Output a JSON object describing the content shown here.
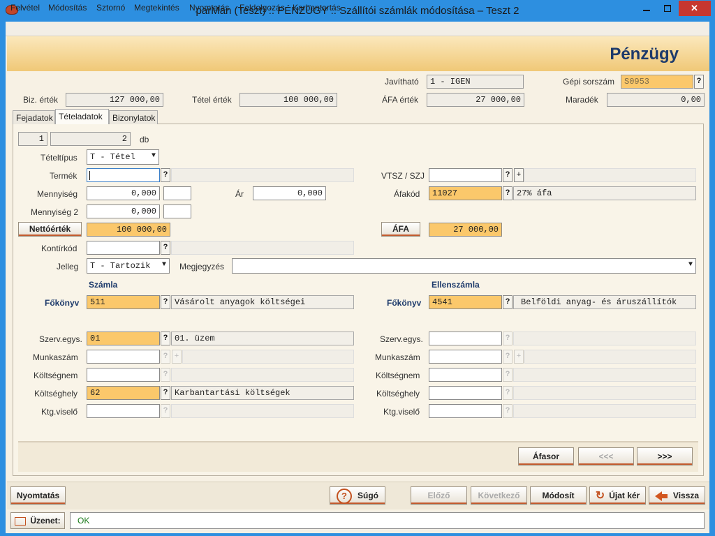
{
  "window": {
    "title": "parMan (Teszt) :: PÉNZÜGY :: Szállítói számlák módosítása   –   Teszt 2"
  },
  "menu": [
    "Felvétel",
    "Módosítás",
    "Sztornó",
    "Megtekintés",
    "Nyomtatás",
    "Feldolgozás",
    "Karbantartás"
  ],
  "banner": {
    "title": "Pénzügy"
  },
  "header": {
    "javithato_label": "Javítható",
    "javithato_value": "1 - IGEN",
    "gepi_label": "Gépi sorszám",
    "gepi_value": "S0953",
    "biz_label": "Biz. érték",
    "biz_value": "127 000,00",
    "tetel_label": "Tétel érték",
    "tetel_value": "100 000,00",
    "afa_label": "ÁFA érték",
    "afa_value": "27 000,00",
    "maradek_label": "Maradék",
    "maradek_value": "0,00"
  },
  "tabs": [
    "Fejadatok",
    "Tételadatok",
    "Bizonylatok"
  ],
  "counter": {
    "current": "1",
    "total": "2",
    "unit": "db"
  },
  "form": {
    "teteltipus_label": "Tételtípus",
    "teteltipus_value": "T - Tétel",
    "termek_label": "Termék",
    "termek_value": "",
    "vtsz_label": "VTSZ / SZJ",
    "vtsz_value": "",
    "mennyiseg_label": "Mennyiség",
    "mennyiseg_value": "0,000",
    "ar_label": "Ár",
    "ar_value": "0,000",
    "afakod_label": "Áfakód",
    "afakod_value": "11027",
    "afakod_desc": "27% áfa",
    "mennyiseg2_label": "Mennyiség 2",
    "mennyiseg2_value": "0,000",
    "netto_button": "Nettóérték",
    "netto_value": "100 000,00",
    "afa_button": "ÁFA",
    "afa_value": "27 000,00",
    "kontir_label": "Kontírkód",
    "kontir_value": "",
    "jelleg_label": "Jelleg",
    "jelleg_value": "T - Tartozik",
    "megjegyzes_label": "Megjegyzés",
    "megjegyzes_value": ""
  },
  "szamla": {
    "heading": "Számla",
    "fokonyv_label": "Főkönyv",
    "fokonyv_value": "511",
    "fokonyv_desc": "Vásárolt anyagok költségei",
    "szerv_label": "Szerv.egys.",
    "szerv_value": "01",
    "szerv_desc": "01. üzem",
    "munka_label": "Munkaszám",
    "koltsegnem_label": "Költségnem",
    "koltseghely_label": "Költséghely",
    "koltseghely_value": "62",
    "koltseghely_desc": "Karbantartási költségek",
    "ktg_label": "Ktg.viselő"
  },
  "ellenszamla": {
    "heading": "Ellenszámla",
    "fokonyv_label": "Főkönyv",
    "fokonyv_value": "4541",
    "fokonyv_desc": "Belföldi anyag- és áruszállítók",
    "szerv_label": "Szerv.egys.",
    "munka_label": "Munkaszám",
    "koltsegnem_label": "Költségnem",
    "koltseghely_label": "Költséghely",
    "ktg_label": "Ktg.viselő"
  },
  "nav": {
    "afasor": "Áfasor",
    "prev": "<<<",
    "next": ">>>"
  },
  "bottom": {
    "print": "Nyomtatás",
    "help": "Súgó",
    "elozo": "Előző",
    "kovetkezo": "Következő",
    "modosit": "Módosít",
    "ujat": "Újat kér",
    "vissza": "Vissza"
  },
  "message": {
    "label": "Üzenet:",
    "text": "OK"
  },
  "qmark": "?",
  "plus": "+"
}
